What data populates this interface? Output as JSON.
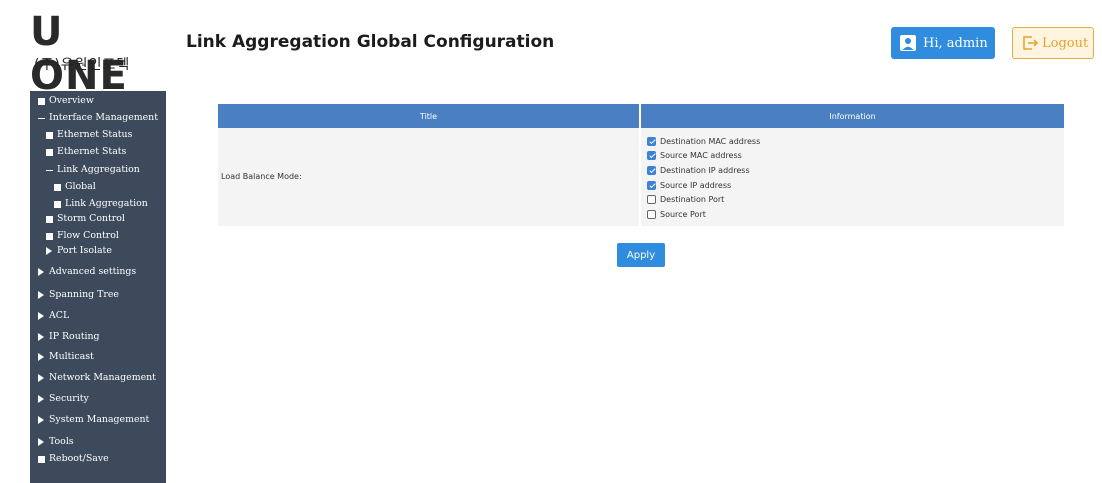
{
  "logo": {
    "main": "U ONE",
    "sub": "(주)유원인포텍"
  },
  "header": {
    "title": "Link Aggregation Global Configuration",
    "user_label": "Hi, admin",
    "logout_label": "Logout"
  },
  "sidebar": {
    "items": [
      {
        "label": "Overview",
        "icon": "square"
      },
      {
        "label": "Interface Management",
        "icon": "minus"
      },
      {
        "label": "Ethernet Status",
        "icon": "square"
      },
      {
        "label": "Ethernet Stats",
        "icon": "square"
      },
      {
        "label": "Link Aggregation",
        "icon": "minus"
      },
      {
        "label": "Global",
        "icon": "square"
      },
      {
        "label": "Link Aggregation",
        "icon": "square"
      },
      {
        "label": "Storm Control",
        "icon": "square"
      },
      {
        "label": "Flow Control",
        "icon": "square"
      },
      {
        "label": "Port Isolate",
        "icon": "triangle"
      },
      {
        "label": "Advanced settings",
        "icon": "triangle"
      },
      {
        "label": "Spanning Tree",
        "icon": "triangle"
      },
      {
        "label": "ACL",
        "icon": "triangle"
      },
      {
        "label": "IP Routing",
        "icon": "triangle"
      },
      {
        "label": "Multicast",
        "icon": "triangle"
      },
      {
        "label": "Network Management",
        "icon": "triangle"
      },
      {
        "label": "Security",
        "icon": "triangle"
      },
      {
        "label": "System Management",
        "icon": "triangle"
      },
      {
        "label": "Tools",
        "icon": "triangle"
      },
      {
        "label": "Reboot/Save",
        "icon": "square"
      }
    ]
  },
  "table": {
    "headers": [
      "Title",
      "Information"
    ],
    "row_label": "Load Balance Mode:",
    "options": [
      {
        "label": "Destination MAC address",
        "checked": true
      },
      {
        "label": "Source MAC address",
        "checked": true
      },
      {
        "label": "Destination IP address",
        "checked": true
      },
      {
        "label": "Source IP address",
        "checked": true
      },
      {
        "label": "Destination Port",
        "checked": false
      },
      {
        "label": "Source Port",
        "checked": false
      }
    ]
  },
  "actions": {
    "apply_label": "Apply"
  },
  "colors": {
    "sidebar_bg": "#3d4a5c",
    "table_header_bg": "#4a7fc1",
    "primary_button": "#2f8cde",
    "logout_border": "#e6ad46"
  }
}
